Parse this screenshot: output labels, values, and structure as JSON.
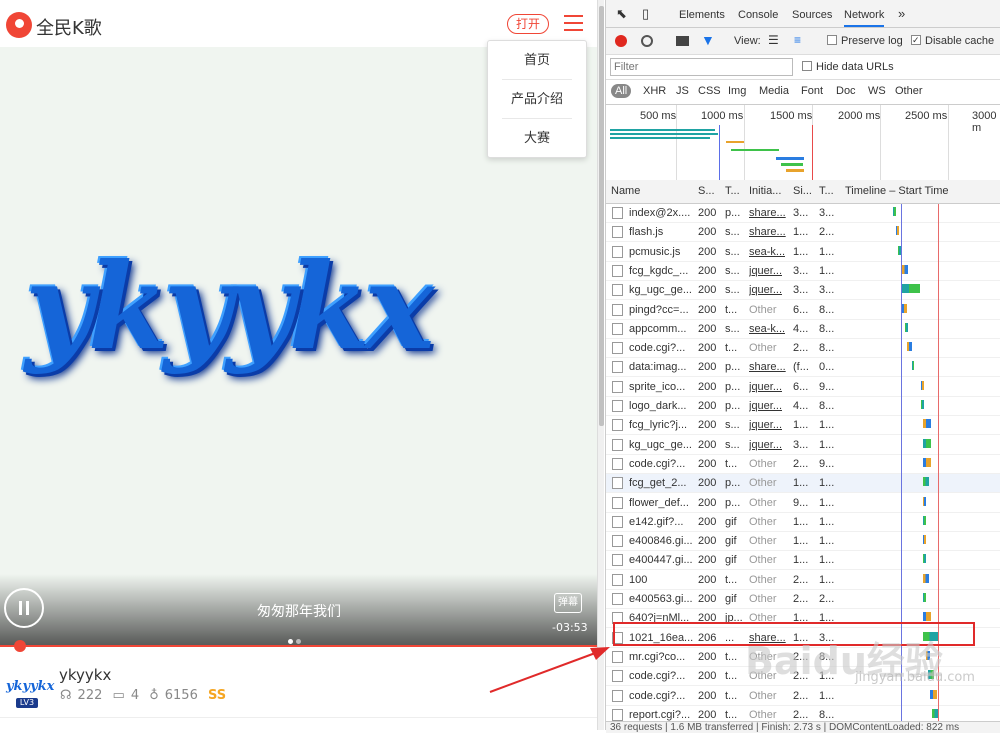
{
  "app": {
    "name": "全民K歌",
    "open_label": "打开"
  },
  "menu": {
    "items": [
      "首页",
      "产品介绍",
      "大赛"
    ]
  },
  "player": {
    "cover_text": "ykyykx",
    "lyric": "匆匆那年我们",
    "danmu_label": "弹幕",
    "remaining": "-03:53",
    "progress_fraction": 0.03
  },
  "user": {
    "avatar_text": "ykyykx",
    "level": "LV3",
    "name": "ykyykx",
    "listens": "222",
    "comments": "4",
    "flowers": "6156",
    "badge": "SS"
  },
  "devtools": {
    "tabs": [
      "Elements",
      "Console",
      "Sources",
      "Network"
    ],
    "active_tab": "Network",
    "more": "»",
    "view_label": "View:",
    "preserve_log": "Preserve log",
    "disable_cache": "Disable cache",
    "filter_placeholder": "Filter",
    "hide_data_urls": "Hide data URLs",
    "types": [
      "All",
      "XHR",
      "JS",
      "CSS",
      "Img",
      "Media",
      "Font",
      "Doc",
      "WS",
      "Other"
    ],
    "ticks": [
      "500 ms",
      "1000 ms",
      "1500 ms",
      "2000 ms",
      "2500 ms",
      "3000 m"
    ],
    "columns": [
      "Name",
      "S...",
      "T...",
      "Initia...",
      "Si...",
      "T...",
      "Timeline – Start Time"
    ],
    "rows": [
      {
        "name": "index@2x....",
        "status": "200",
        "type": "p...",
        "init": "share...",
        "size": "3...",
        "time": "3...",
        "link": true
      },
      {
        "name": "flash.js",
        "status": "200",
        "type": "s...",
        "init": "share...",
        "size": "1...",
        "time": "2...",
        "link": true
      },
      {
        "name": "pcmusic.js",
        "status": "200",
        "type": "s...",
        "init": "sea-k...",
        "size": "1...",
        "time": "1...",
        "link": true
      },
      {
        "name": "fcg_kgdc_...",
        "status": "200",
        "type": "s...",
        "init": "jquer...",
        "size": "3...",
        "time": "1...",
        "link": true
      },
      {
        "name": "kg_ugc_ge...",
        "status": "200",
        "type": "s...",
        "init": "jquer...",
        "size": "3...",
        "time": "3...",
        "link": true
      },
      {
        "name": "pingd?cc=...",
        "status": "200",
        "type": "t...",
        "init": "Other",
        "size": "6...",
        "time": "8...",
        "link": false
      },
      {
        "name": "appcomm...",
        "status": "200",
        "type": "s...",
        "init": "sea-k...",
        "size": "4...",
        "time": "8...",
        "link": true
      },
      {
        "name": "code.cgi?...",
        "status": "200",
        "type": "t...",
        "init": "Other",
        "size": "2...",
        "time": "8...",
        "link": false
      },
      {
        "name": "data:imag...",
        "status": "200",
        "type": "p...",
        "init": "share...",
        "size": "(f...",
        "time": "0...",
        "link": true
      },
      {
        "name": "sprite_ico...",
        "status": "200",
        "type": "p...",
        "init": "jquer...",
        "size": "6...",
        "time": "9...",
        "link": true
      },
      {
        "name": "logo_dark...",
        "status": "200",
        "type": "p...",
        "init": "jquer...",
        "size": "4...",
        "time": "8...",
        "link": true
      },
      {
        "name": "fcg_lyric?j...",
        "status": "200",
        "type": "s...",
        "init": "jquer...",
        "size": "1...",
        "time": "1...",
        "link": true
      },
      {
        "name": "kg_ugc_ge...",
        "status": "200",
        "type": "s...",
        "init": "jquer...",
        "size": "3...",
        "time": "1...",
        "link": true
      },
      {
        "name": "code.cgi?...",
        "status": "200",
        "type": "t...",
        "init": "Other",
        "size": "2...",
        "time": "9...",
        "link": false
      },
      {
        "name": "fcg_get_2...",
        "status": "200",
        "type": "p...",
        "init": "Other",
        "size": "1...",
        "time": "1...",
        "link": false
      },
      {
        "name": "flower_def...",
        "status": "200",
        "type": "p...",
        "init": "Other",
        "size": "9...",
        "time": "1...",
        "link": false
      },
      {
        "name": "e142.gif?...",
        "status": "200",
        "type": "gif",
        "init": "Other",
        "size": "1...",
        "time": "1...",
        "link": false
      },
      {
        "name": "e400846.gi...",
        "status": "200",
        "type": "gif",
        "init": "Other",
        "size": "1...",
        "time": "1...",
        "link": false
      },
      {
        "name": "e400447.gi...",
        "status": "200",
        "type": "gif",
        "init": "Other",
        "size": "1...",
        "time": "1...",
        "link": false
      },
      {
        "name": "100",
        "status": "200",
        "type": "t...",
        "init": "Other",
        "size": "2...",
        "time": "1...",
        "link": false
      },
      {
        "name": "e400563.gi...",
        "status": "200",
        "type": "gif",
        "init": "Other",
        "size": "2...",
        "time": "2...",
        "link": false
      },
      {
        "name": "640?j=nMl...",
        "status": "200",
        "type": "jp...",
        "init": "Other",
        "size": "1...",
        "time": "1...",
        "link": false
      },
      {
        "name": "1021_16ea...",
        "status": "206",
        "type": "...",
        "init": "share...",
        "size": "1...",
        "time": "3...",
        "link": true
      },
      {
        "name": "mr.cgi?co...",
        "status": "200",
        "type": "t...",
        "init": "Other",
        "size": "2...",
        "time": "8...",
        "link": false
      },
      {
        "name": "code.cgi?...",
        "status": "200",
        "type": "t...",
        "init": "Other",
        "size": "2...",
        "time": "1...",
        "link": false
      },
      {
        "name": "code.cgi?...",
        "status": "200",
        "type": "t...",
        "init": "Other",
        "size": "2...",
        "time": "1...",
        "link": false
      },
      {
        "name": "report.cgi?...",
        "status": "200",
        "type": "t...",
        "init": "Other",
        "size": "2...",
        "time": "8...",
        "link": false
      }
    ],
    "status_bar": "36 requests | 1.6 MB transferred | Finish: 2.73 s | DOMContentLoaded: 822 ms"
  },
  "watermark": {
    "text": "Baidu经验",
    "sub": "jingyan.baidu.com"
  },
  "colors": {
    "accent": "#f04636",
    "devtools_blue": "#1a73e8",
    "highlight_box": "#e02a2a"
  }
}
